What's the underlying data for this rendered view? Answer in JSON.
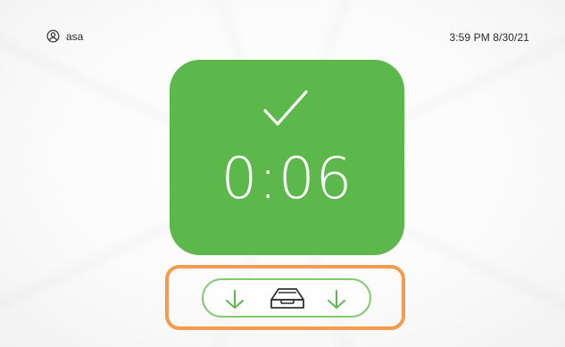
{
  "header": {
    "username": "asa",
    "datetime": "3:59 PM 8/30/21",
    "user_icon": "user-circle-icon"
  },
  "status_card": {
    "status": "success",
    "icon": "checkmark-icon",
    "timer": "0:06",
    "color": "#5db84c"
  },
  "output_tray": {
    "icons": [
      "arrow-down-icon",
      "output-tray-icon",
      "arrow-down-icon"
    ],
    "highlight_color": "#f49b4d",
    "pill_color": "#7fca6d"
  }
}
